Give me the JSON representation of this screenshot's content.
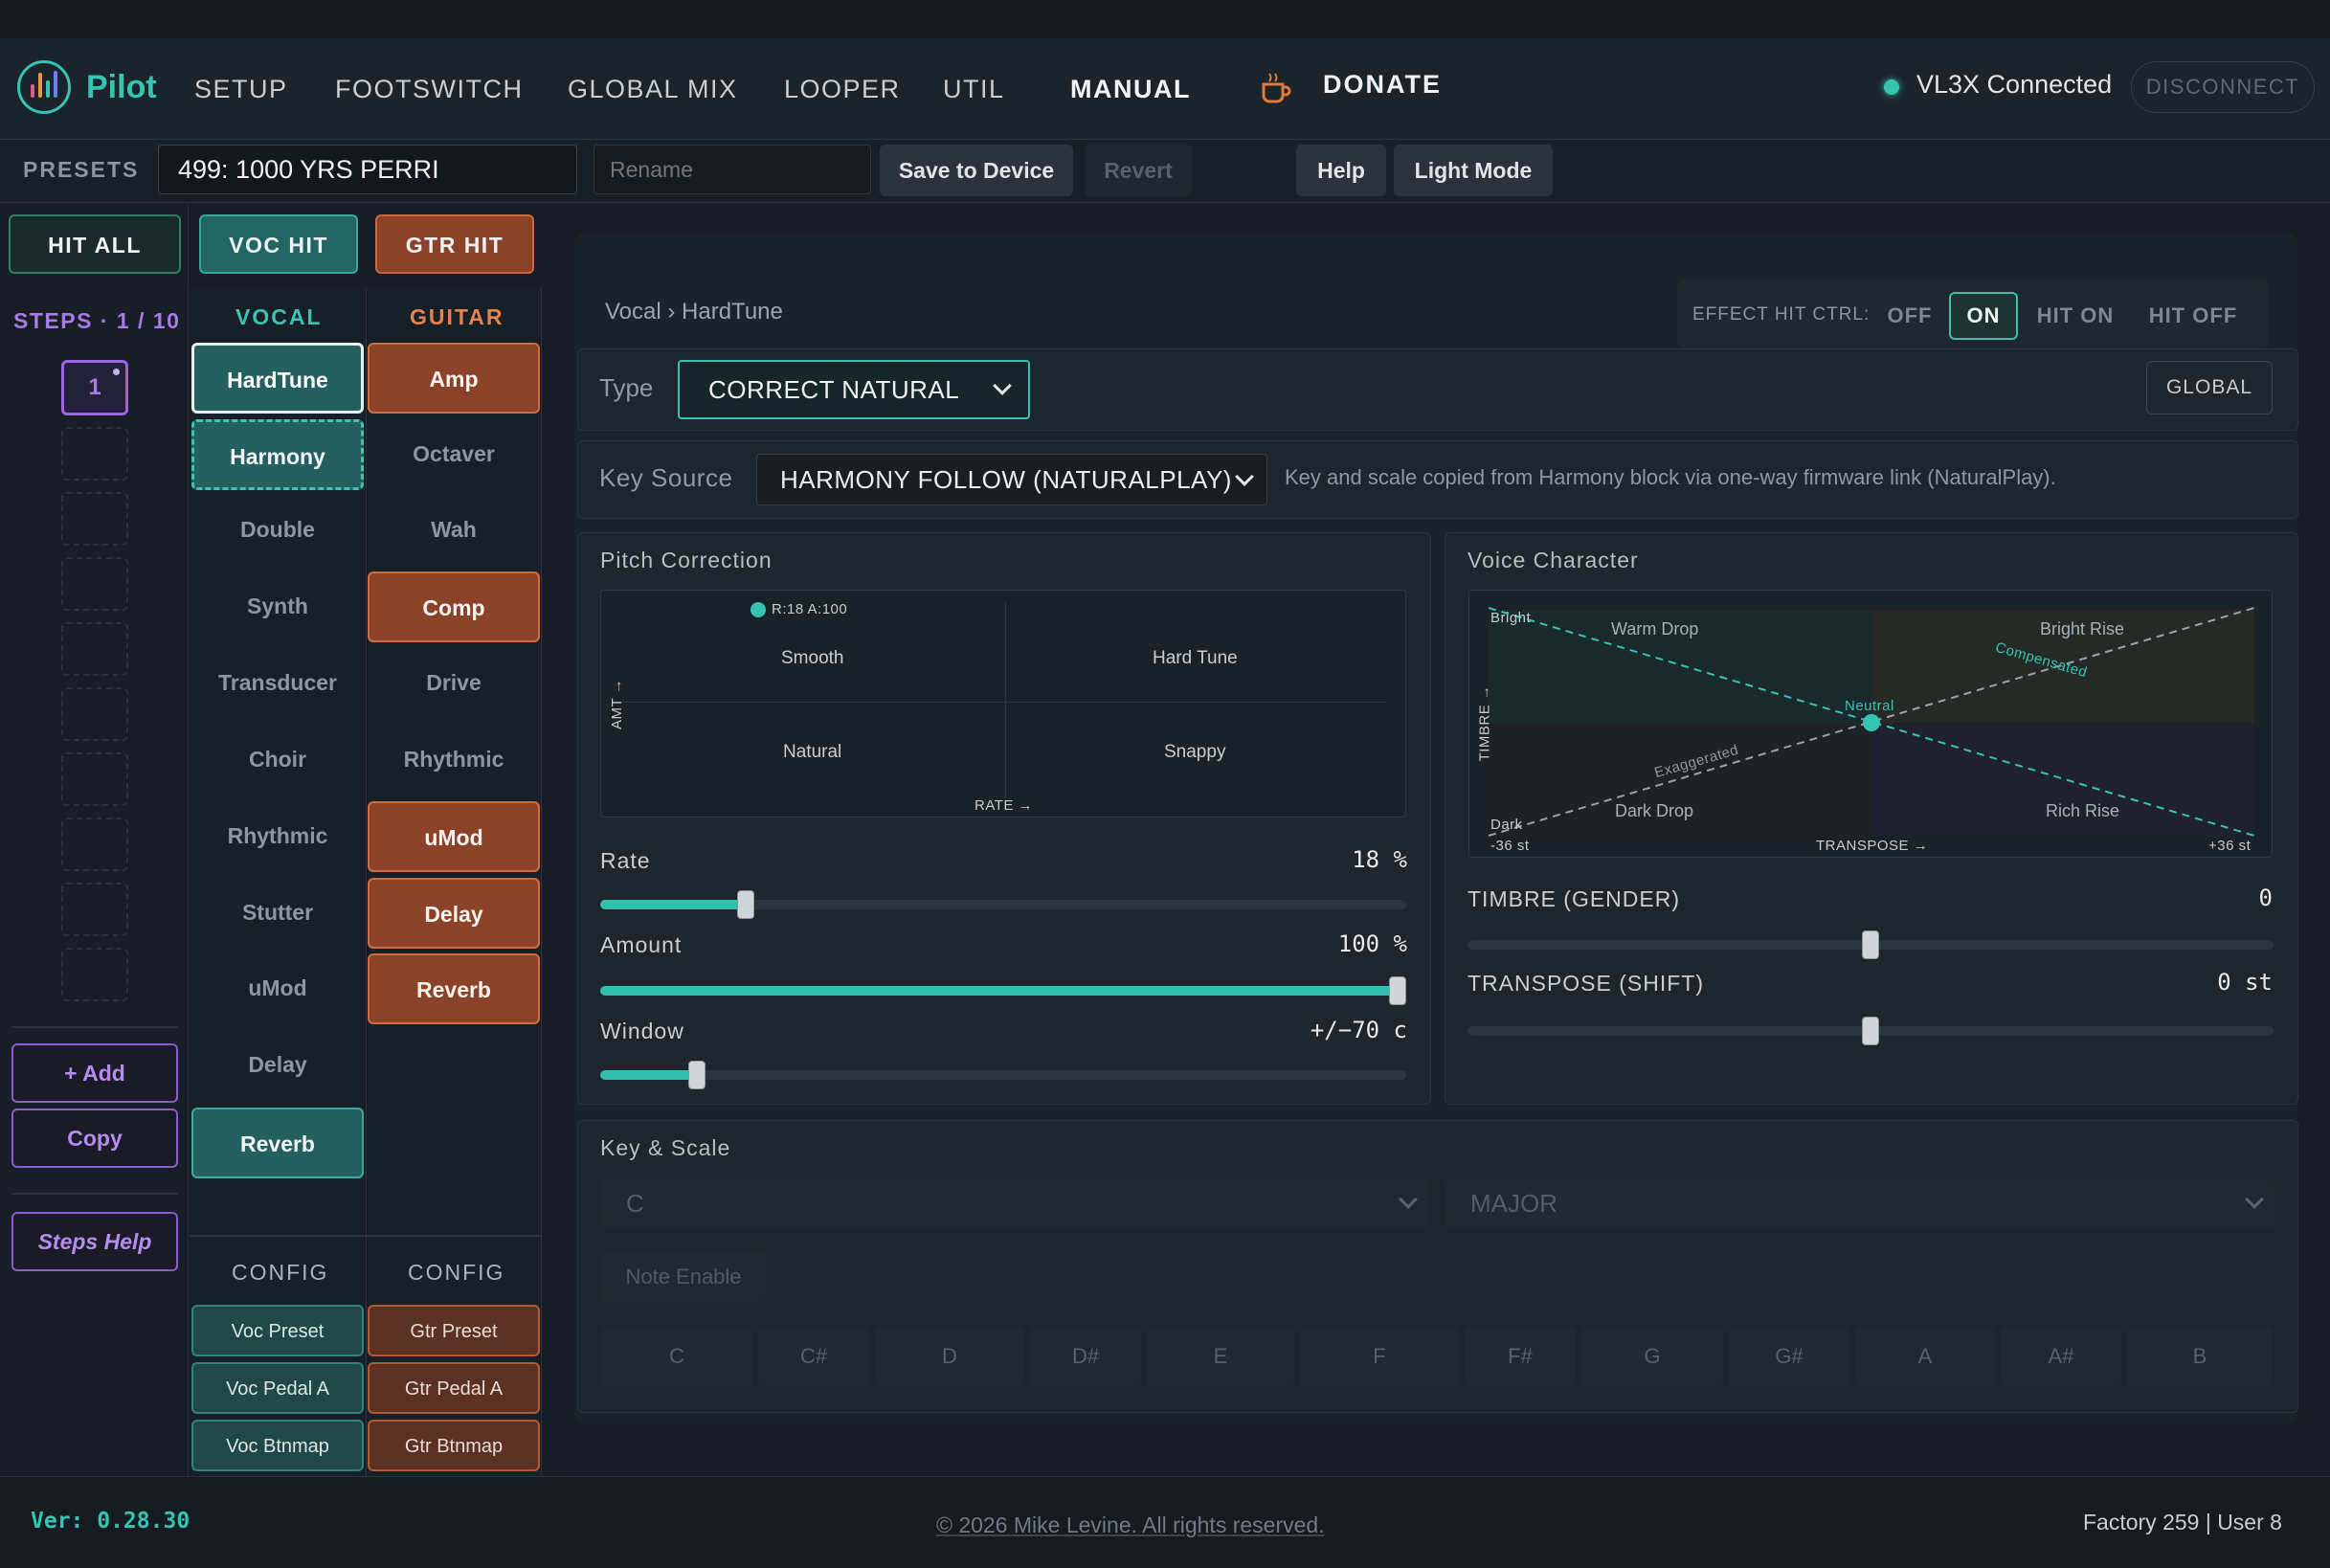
{
  "nav": {
    "brand": "Pilot",
    "items": [
      "SETUP",
      "FOOTSWITCH",
      "GLOBAL MIX",
      "LOOPER",
      "UTIL",
      "MANUAL"
    ],
    "active": "MANUAL",
    "donate": "DONATE",
    "connection_status": "VL3X Connected",
    "disconnect": "DISCONNECT"
  },
  "presets": {
    "label": "PRESETS",
    "current": "499: 1000 YRS PERRI",
    "rename_placeholder": "Rename",
    "save": "Save to Device",
    "revert": "Revert",
    "help": "Help",
    "light_mode": "Light Mode"
  },
  "hit_buttons": {
    "all": "HIT ALL",
    "voc": "VOC HIT",
    "gtr": "GTR HIT"
  },
  "steps": {
    "label": "STEPS · 1 / 10",
    "current": "1",
    "add": "+ Add",
    "copy": "Copy",
    "help": "Steps Help"
  },
  "vocal": {
    "title": "VOCAL",
    "blocks": [
      {
        "label": "HardTune",
        "state": "selected"
      },
      {
        "label": "Harmony",
        "state": "linked"
      },
      {
        "label": "Double",
        "state": "off"
      },
      {
        "label": "Synth",
        "state": "off"
      },
      {
        "label": "Transducer",
        "state": "off"
      },
      {
        "label": "Choir",
        "state": "off"
      },
      {
        "label": "Rhythmic",
        "state": "off"
      },
      {
        "label": "Stutter",
        "state": "off"
      },
      {
        "label": "uMod",
        "state": "off"
      },
      {
        "label": "Delay",
        "state": "off"
      },
      {
        "label": "Reverb",
        "state": "on"
      }
    ],
    "config_title": "CONFIG",
    "config": [
      "Voc Preset",
      "Voc Pedal A",
      "Voc Btnmap"
    ]
  },
  "guitar": {
    "title": "GUITAR",
    "blocks": [
      {
        "label": "Amp",
        "state": "on"
      },
      {
        "label": "Octaver",
        "state": "off"
      },
      {
        "label": "Wah",
        "state": "off"
      },
      {
        "label": "Comp",
        "state": "on"
      },
      {
        "label": "Drive",
        "state": "off"
      },
      {
        "label": "Rhythmic",
        "state": "off"
      },
      {
        "label": "uMod",
        "state": "on"
      },
      {
        "label": "Delay",
        "state": "on"
      },
      {
        "label": "Reverb",
        "state": "on"
      }
    ],
    "config_title": "CONFIG",
    "config": [
      "Gtr Preset",
      "Gtr Pedal A",
      "Gtr Btnmap"
    ]
  },
  "editor": {
    "breadcrumb": "Vocal › HardTune",
    "effect_hit": {
      "label": "EFFECT HIT CTRL:",
      "options": [
        "OFF",
        "ON",
        "HIT ON",
        "HIT OFF"
      ],
      "selected": "ON"
    },
    "type_label": "Type",
    "type_value": "CORRECT NATURAL",
    "global": "GLOBAL",
    "key_source_label": "Key Source",
    "key_source_value": "HARMONY FOLLOW (NATURALPLAY)",
    "key_source_note": "Key and scale copied from Harmony block via one-way firmware link (NaturalPlay)."
  },
  "pitch_correction": {
    "title": "Pitch Correction",
    "readout": "R:18 A:100",
    "quadrants": [
      "Smooth",
      "Hard Tune",
      "Natural",
      "Snappy"
    ],
    "x_axis": "RATE →",
    "y_axis": "AMT →",
    "point": {
      "rate": 18,
      "amount": 100
    },
    "sliders": [
      {
        "label": "Rate",
        "value": "18 %",
        "fraction": 0.18
      },
      {
        "label": "Amount",
        "value": "100 %",
        "fraction": 1.0
      },
      {
        "label": "Window",
        "value": "+/−70 c",
        "fraction": 0.12
      }
    ]
  },
  "voice_character": {
    "title": "Voice Character",
    "corners": [
      "Bright",
      "Dark"
    ],
    "regions": [
      "Warm Drop",
      "Bright Rise",
      "Dark Drop",
      "Rich Rise"
    ],
    "line_labels": [
      "Compensated",
      "Exaggerated"
    ],
    "center_label": "Neutral",
    "x_min": "-36 st",
    "x_axis": "TRANSPOSE →",
    "x_max": "+36 st",
    "y_axis": "TIMBRE →",
    "point": {
      "transpose": 0,
      "timbre": 0
    },
    "sliders": [
      {
        "label": "TIMBRE (GENDER)",
        "value": "0",
        "fraction": 0.5
      },
      {
        "label": "TRANSPOSE (SHIFT)",
        "value": "0 st",
        "fraction": 0.5
      }
    ]
  },
  "key_scale": {
    "title": "Key & Scale",
    "key": "C",
    "scale": "MAJOR",
    "note_enable": "Note Enable",
    "notes": [
      "C",
      "C#",
      "D",
      "D#",
      "E",
      "F",
      "F#",
      "G",
      "G#",
      "A",
      "A#",
      "B"
    ]
  },
  "footer": {
    "version": "Ver: 0.28.30",
    "copyright": "© 2026 Mike Levine. All rights reserved.",
    "counts": "Factory 259 | User 8"
  },
  "colors": {
    "accent_teal": "#35c3b2",
    "guitar_orange": "#c9683e",
    "steps_purple": "#9a64e3"
  }
}
